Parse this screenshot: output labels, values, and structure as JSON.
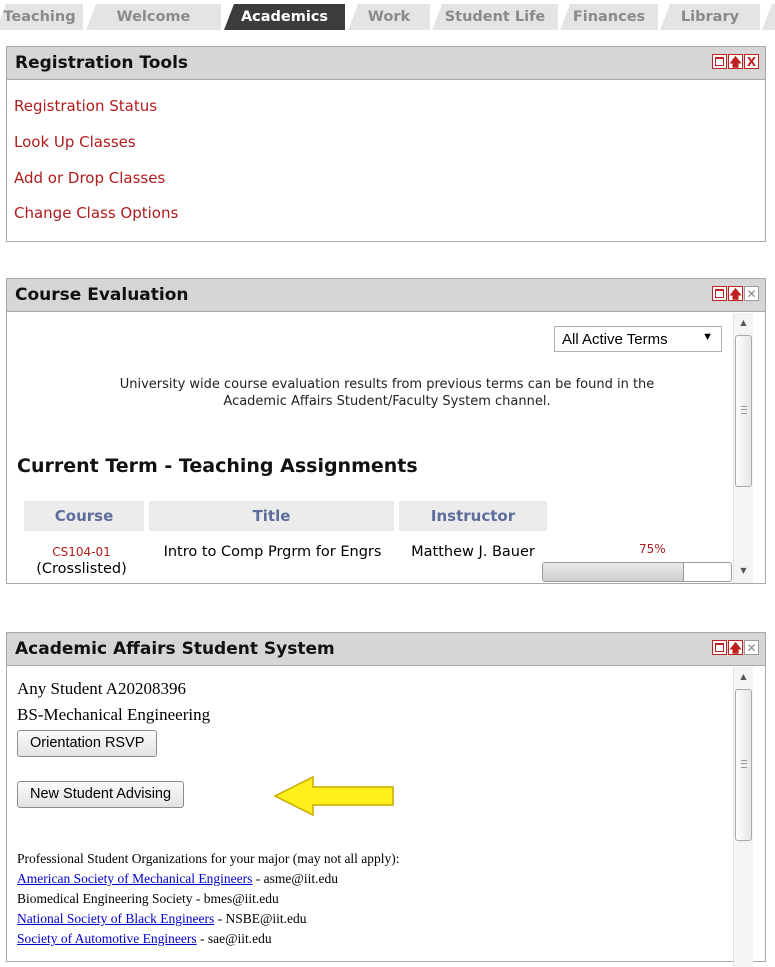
{
  "tabs": [
    {
      "label": "Teaching",
      "active": false
    },
    {
      "label": "Welcome",
      "active": false
    },
    {
      "label": "Academics",
      "active": true
    },
    {
      "label": "Work",
      "active": false
    },
    {
      "label": "Student Life",
      "active": false
    },
    {
      "label": "Finances",
      "active": false
    },
    {
      "label": "Library",
      "active": false
    }
  ],
  "registration_tools": {
    "title": "Registration Tools",
    "links": [
      "Registration Status",
      "Look Up Classes",
      "Add or Drop Classes",
      "Change Class Options"
    ],
    "controls": {
      "minimize": "minimize-icon",
      "maximize": "move-up-icon",
      "close": "X"
    }
  },
  "course_evaluation": {
    "title": "Course Evaluation",
    "term_select": "All Active Terms",
    "info_line1": "University wide course evaluation results from previous terms can be found in the",
    "info_line2": "Academic Affairs Student/Faculty System channel.",
    "section_title": "Current Term - Teaching Assignments",
    "columns": [
      "Course",
      "Title",
      "Instructor"
    ],
    "rows": [
      {
        "course": "CS104-01",
        "crosslisted": "(Crosslisted)",
        "title": "Intro to Comp Prgrm for Engrs",
        "instructor": "Matthew J. Bauer",
        "percent_label": "75%",
        "progress": 0.75
      }
    ]
  },
  "academic_affairs": {
    "title": "Academic Affairs Student System",
    "student_line": "Any Student A20208396",
    "program_line": "BS-Mechanical Engineering",
    "orientation_button": "Orientation RSVP",
    "advising_button": "New Student Advising",
    "orgs_heading": "Professional Student Organizations for your major (may not all apply):",
    "orgs": [
      {
        "name": "American Society of Mechanical Engineers",
        "linked": true,
        "email": " - asme@iit.edu"
      },
      {
        "name": "Biomedical Engineering Society",
        "linked": false,
        "email": " - bmes@iit.edu"
      },
      {
        "name": "National Society of Black Engineers",
        "linked": true,
        "email": " - NSBE@iit.edu"
      },
      {
        "name": "Society of Automotive Engineers",
        "linked": true,
        "email": " - sae@iit.edu"
      }
    ]
  },
  "colors": {
    "link_red": "#b01c1c",
    "header_gray": "#d6d6d6",
    "active_tab": "#3c3c3c",
    "arrow_yellow": "#ffef1a"
  }
}
